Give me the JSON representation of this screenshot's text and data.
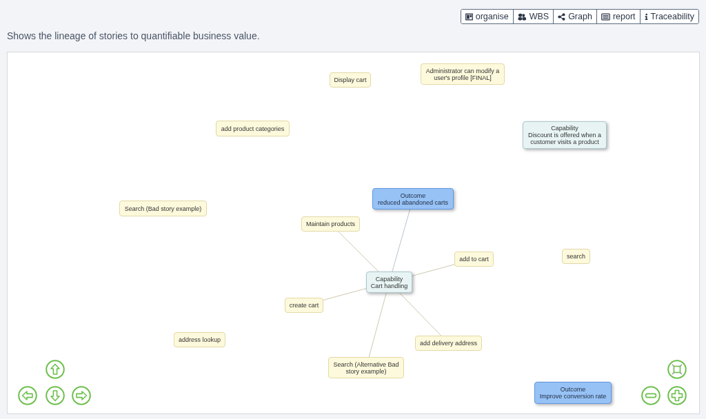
{
  "toolbar": {
    "buttons": [
      {
        "label": "organise"
      },
      {
        "label": "WBS"
      },
      {
        "label": "Graph"
      },
      {
        "label": "report"
      },
      {
        "label": "Traceability"
      }
    ]
  },
  "description": "Shows the lineage of stories to quantifiable business value.",
  "graph": {
    "nodes": [
      {
        "kind": "story",
        "label": "Display cart"
      },
      {
        "kind": "story",
        "label": "Administrator can modify a user's profile [FINAL]"
      },
      {
        "kind": "story",
        "label": "add product categories"
      },
      {
        "kind": "capability",
        "type_label": "Capability",
        "label": "Discount is offered when a customer visits a product"
      },
      {
        "kind": "outcome",
        "type_label": "Outcome",
        "label": "reduced abandoned carts",
        "children": [
          {
            "kind": "capability",
            "type_label": "Capability",
            "label": "Cart handling",
            "children": [
              {
                "kind": "story",
                "label": "Maintain products"
              },
              {
                "kind": "story",
                "label": "add to cart"
              },
              {
                "kind": "story",
                "label": "create cart"
              },
              {
                "kind": "story",
                "label": "add delivery address"
              },
              {
                "kind": "story",
                "label": "Search (Alternative Bad story example)"
              }
            ]
          }
        ]
      },
      {
        "kind": "story",
        "label": "Search (Bad story example)"
      },
      {
        "kind": "story",
        "label": "search"
      },
      {
        "kind": "story",
        "label": "address lookup"
      },
      {
        "kind": "outcome",
        "type_label": "Outcome",
        "label": "Improve conversion rate"
      }
    ]
  }
}
